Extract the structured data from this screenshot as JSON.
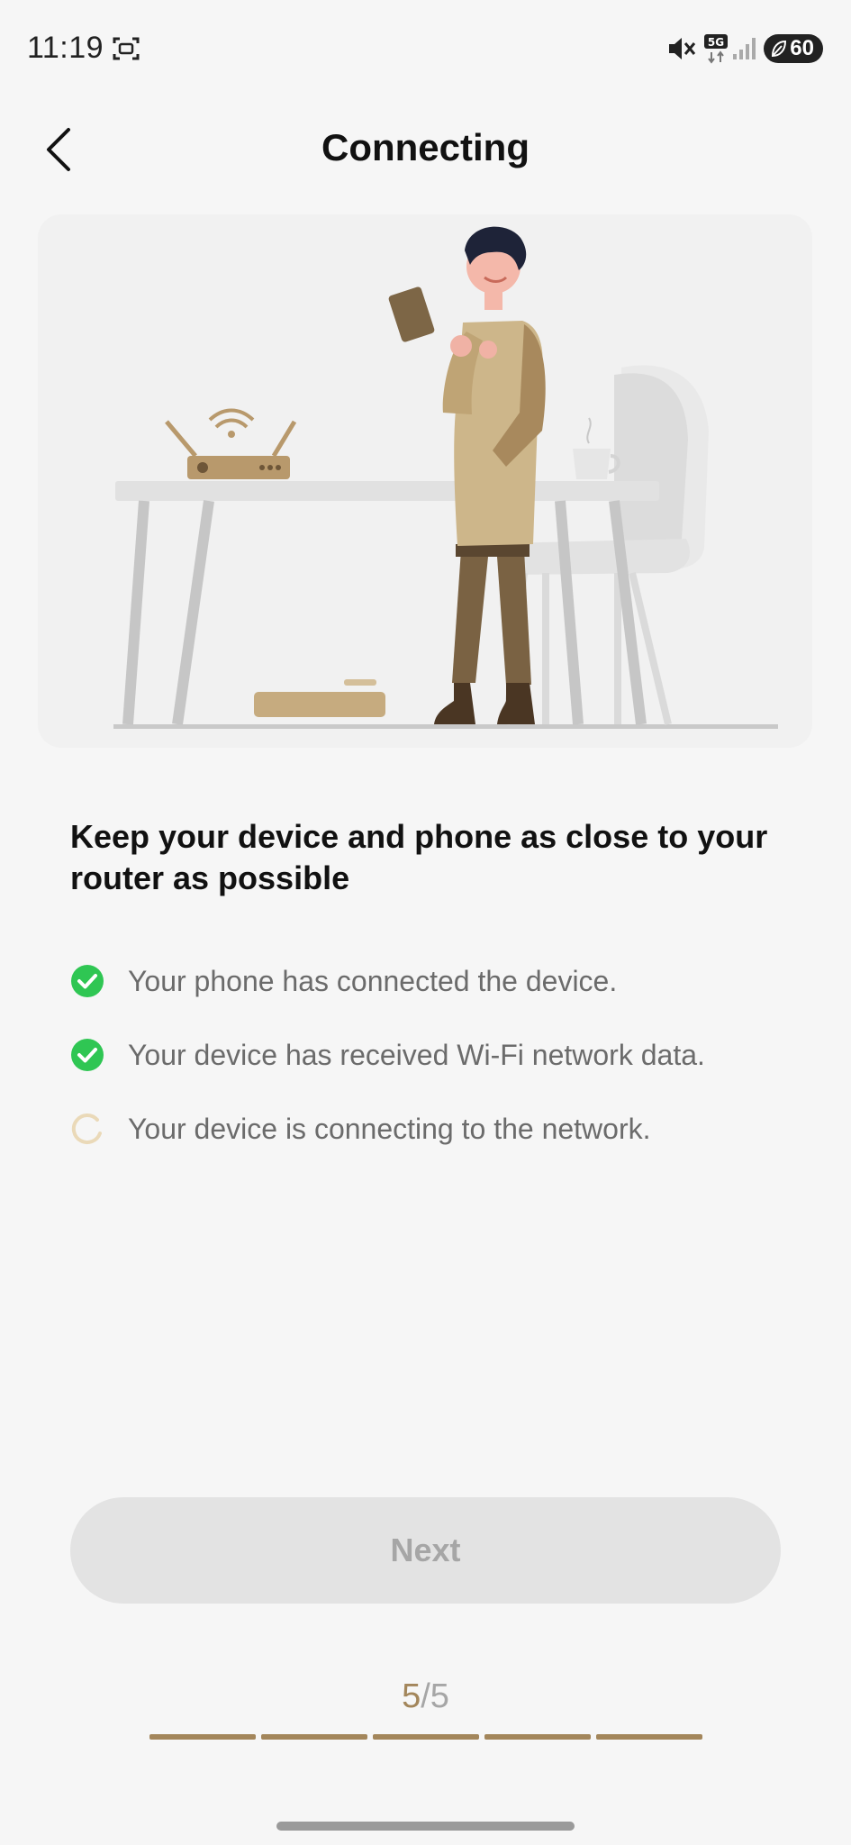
{
  "status_bar": {
    "time": "11:19",
    "network": "5G",
    "battery": "60",
    "icons": [
      "screenshot-icon",
      "mute-icon",
      "5g-icon",
      "signal-icon",
      "battery-icon"
    ]
  },
  "header": {
    "title": "Connecting",
    "back_icon": "chevron-left-icon"
  },
  "instructions": {
    "title": "Keep your device and phone as close to your router as possible",
    "steps": [
      {
        "text": "Your phone has connected the device.",
        "status": "done"
      },
      {
        "text": "Your device has received Wi-Fi network data.",
        "status": "done"
      },
      {
        "text": "Your device is connecting to the network.",
        "status": "loading"
      }
    ]
  },
  "next_button": {
    "label": "Next",
    "enabled": false
  },
  "pager": {
    "current": "5",
    "separator": "/",
    "total": "5",
    "progress": 1.0
  },
  "colors": {
    "accent": "#a3865b",
    "success": "#2fc653",
    "background": "#f6f6f6",
    "button_disabled_bg": "#e3e3e3",
    "button_disabled_text": "#a6a6a6"
  }
}
